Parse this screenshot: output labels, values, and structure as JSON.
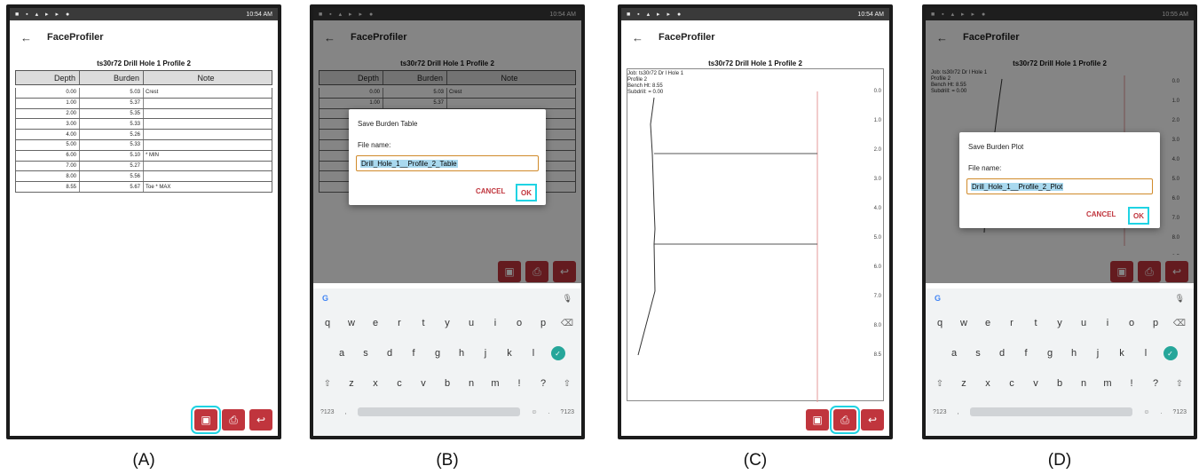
{
  "app": {
    "title": "FaceProfiler",
    "table_title": "ts30r72 Drill Hole 1  Profile 2",
    "back_icon": "arrow-left-icon"
  },
  "status_times": [
    "10:54 AM",
    "10:54 AM",
    "10:54 AM",
    "10:55 AM"
  ],
  "table": {
    "headers": [
      "Depth",
      "Burden",
      "Note"
    ],
    "rows": [
      [
        "0.00",
        "5.03",
        "Crest"
      ],
      [
        "1.00",
        "5.37",
        ""
      ],
      [
        "2.00",
        "5.35",
        ""
      ],
      [
        "3.00",
        "5.33",
        ""
      ],
      [
        "4.00",
        "5.26",
        ""
      ],
      [
        "5.00",
        "5.33",
        ""
      ],
      [
        "6.00",
        "5.10",
        "* MIN"
      ],
      [
        "7.00",
        "5.27",
        ""
      ],
      [
        "8.00",
        "5.56",
        ""
      ],
      [
        "8.55",
        "5.67",
        "Toe * MAX"
      ]
    ]
  },
  "dialog_table": {
    "title": "Save Burden Table",
    "label": "File name:",
    "value": "Drill_Hole_1__Profile_2_Table",
    "cancel": "CANCEL",
    "ok": "OK"
  },
  "dialog_plot": {
    "title": "Save Burden Plot",
    "label": "File name:",
    "value": "Drill_Hole_1__Profile_2_Plot",
    "cancel": "CANCEL",
    "ok": "OK"
  },
  "plot_info": {
    "job": "Job: ts30r72 Dr  l Hole 1",
    "profile": "Profile 2",
    "bench": "Bench Ht: 8.55",
    "subdrill": "Subdrill: = 0.00"
  },
  "plot_depth_ticks": [
    "0.0",
    "1.0",
    "2.0",
    "3.0",
    "4.0",
    "5.0",
    "6.0",
    "7.0",
    "8.0",
    "8.5"
  ],
  "plot_point_labels": [
    "0",
    "7",
    "4",
    "3"
  ],
  "keyboard": {
    "row1": [
      "q",
      "w",
      "e",
      "r",
      "t",
      "y",
      "u",
      "i",
      "o",
      "p"
    ],
    "row1_hints": [
      "1",
      "2",
      "3",
      "4",
      "5",
      "6",
      "7",
      "8",
      "9",
      "0"
    ],
    "row2": [
      "a",
      "s",
      "d",
      "f",
      "g",
      "h",
      "j",
      "k",
      "l"
    ],
    "row3": [
      "z",
      "x",
      "c",
      "v",
      "b",
      "n",
      "m",
      "!",
      "?"
    ],
    "sym": "?123",
    "comma": ",",
    "period": "."
  },
  "captions": [
    "(A)",
    "(B)",
    "(C)",
    "(D)"
  ],
  "colors": {
    "accent_red": "#c0353d",
    "highlight": "#1fd3e3"
  }
}
